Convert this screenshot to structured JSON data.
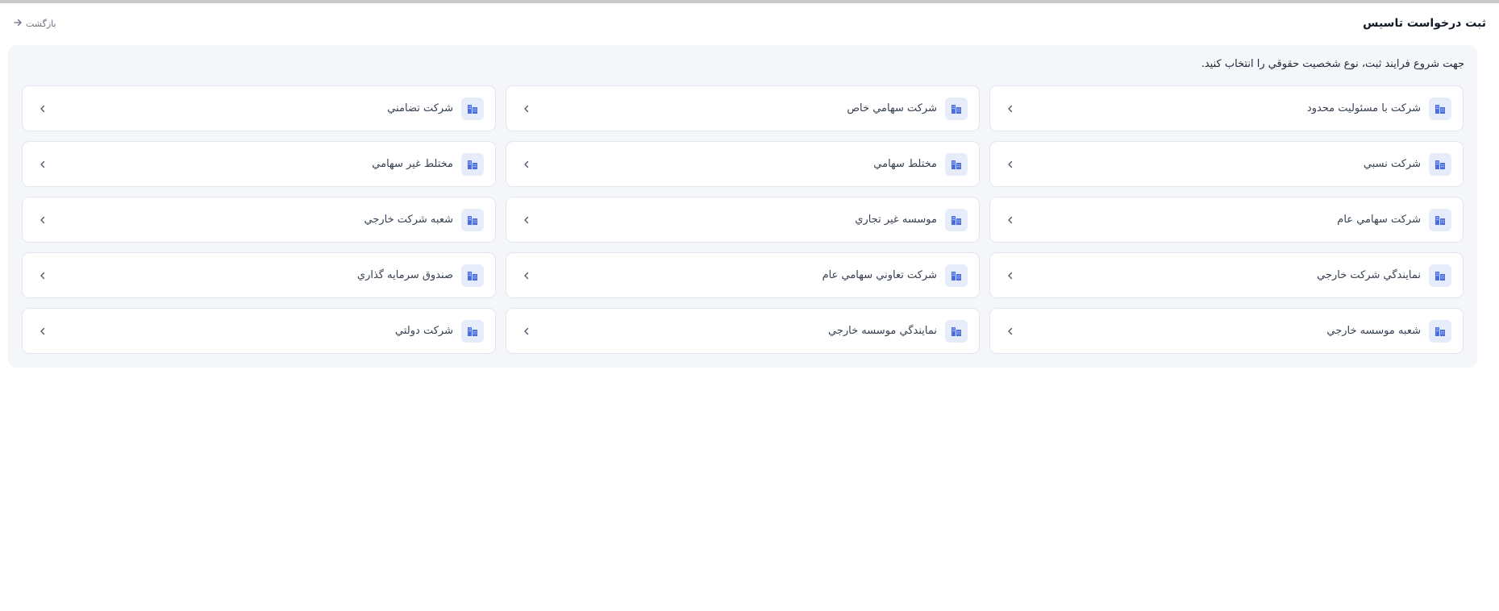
{
  "header": {
    "title": "ثبت درخواست تاسیس",
    "back_label": "بازگشت"
  },
  "panel": {
    "instruction": "جهت شروع فرايند ثبت، نوع شخصيت حقوقي را انتخاب کنيد."
  },
  "entity_types": [
    {
      "label": "شركت با مسئوليت محدود"
    },
    {
      "label": "شركت سهامي خاص"
    },
    {
      "label": "شركت تضامني"
    },
    {
      "label": "شركت نسبي"
    },
    {
      "label": "مختلط سهامي"
    },
    {
      "label": "مختلط غير سهامي"
    },
    {
      "label": "شركت سهامي عام"
    },
    {
      "label": "موسسه غير تجاري"
    },
    {
      "label": "شعبه شركت خارجي"
    },
    {
      "label": "نمايندگي شركت خارجي"
    },
    {
      "label": "شركت تعاوني سهامي عام"
    },
    {
      "label": "صندوق سرمايه گذاري"
    },
    {
      "label": "شعبه موسسه خارجي"
    },
    {
      "label": "نمايندگي موسسه خارجي"
    },
    {
      "label": "شركت دولتي"
    }
  ],
  "icons": {
    "card_icon": "building-icon",
    "card_arrow": "chevron-left-icon",
    "back_icon": "arrow-right-icon"
  },
  "colors": {
    "accent": "#4f6fd6",
    "icon_bg": "#e6ecfa",
    "panel_bg": "#f4f6fa"
  }
}
